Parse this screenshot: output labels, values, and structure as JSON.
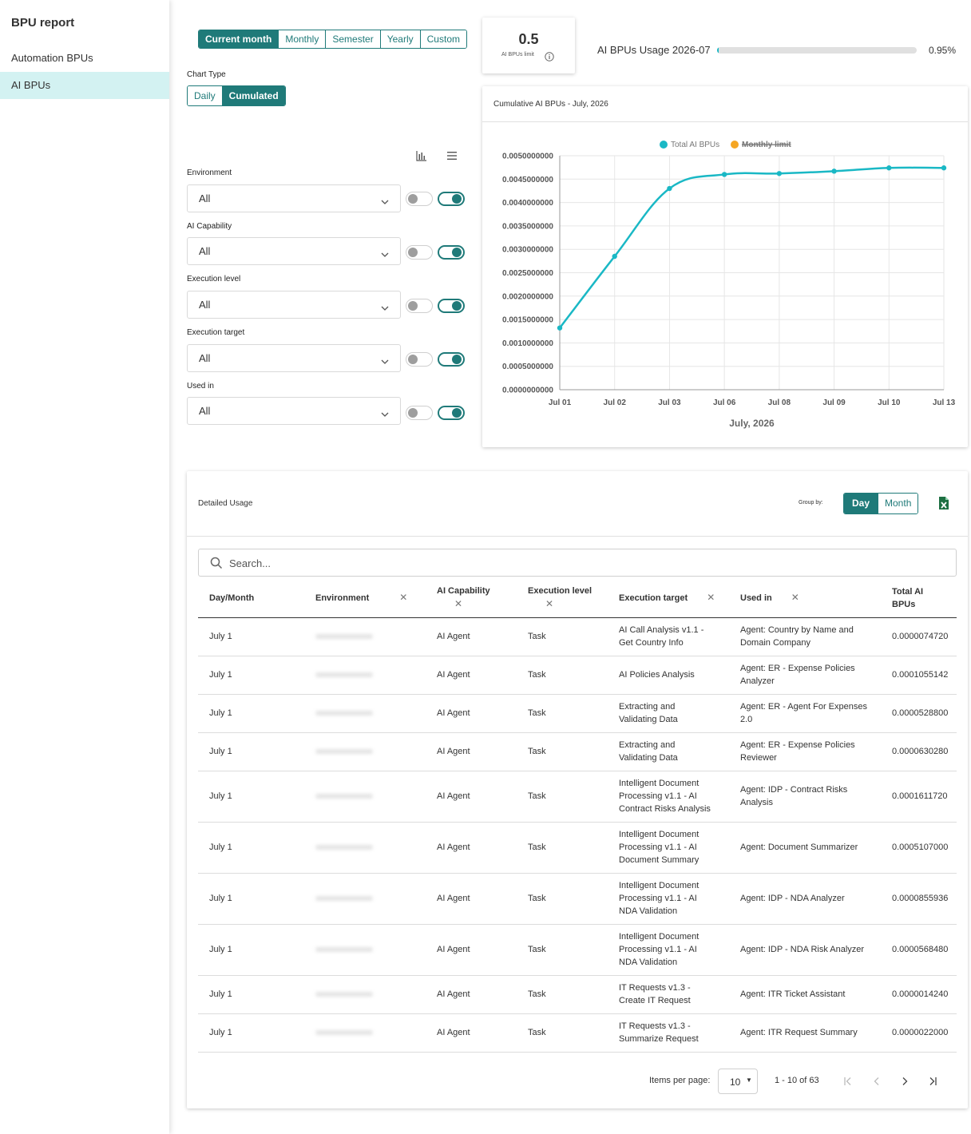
{
  "sidebar": {
    "title": "BPU report",
    "items": [
      {
        "label": "Automation BPUs",
        "active": false
      },
      {
        "label": "AI BPUs",
        "active": true
      }
    ]
  },
  "period_tabs": [
    "Current month",
    "Monthly",
    "Semester",
    "Yearly",
    "Custom"
  ],
  "period_active": "Current month",
  "chart_type": {
    "label": "Chart Type",
    "options": [
      "Daily",
      "Cumulated"
    ],
    "active": "Cumulated"
  },
  "view_icons": [
    "bar-chart-icon",
    "menu-icon"
  ],
  "filters": [
    {
      "label": "Environment",
      "value": "All"
    },
    {
      "label": "AI Capability",
      "value": "All"
    },
    {
      "label": "Execution level",
      "value": "All"
    },
    {
      "label": "Execution target",
      "value": "All"
    },
    {
      "label": "Used in",
      "value": "All"
    }
  ],
  "limit_card": {
    "value": "0.5",
    "label": "AI BPUs limit"
  },
  "usage": {
    "label": "AI BPUs Usage 2026-07",
    "percent_text": "0.95%",
    "fraction": 0.0095
  },
  "colors": {
    "accent": "#1f7a79",
    "series": "#1ab8c5",
    "limit": "#f5a623"
  },
  "chart_data": {
    "type": "line",
    "title": "Cumulative AI BPUs - July, 2026",
    "xlabel": "July, 2026",
    "ylabel": "",
    "categories": [
      "Jul 01",
      "Jul 02",
      "Jul 03",
      "Jul 06",
      "Jul 08",
      "Jul 09",
      "Jul 10",
      "Jul 13"
    ],
    "series": [
      {
        "name": "Total AI BPUs",
        "values": [
          0.00132,
          0.00285,
          0.0043,
          0.0046,
          0.00462,
          0.00467,
          0.00474,
          0.00474
        ],
        "visible": true
      },
      {
        "name": "Monthly limit",
        "values": [],
        "visible": false
      }
    ],
    "ylim": [
      0,
      0.005
    ],
    "yticks": [
      "0.0050000000",
      "0.0045000000",
      "0.0040000000",
      "0.0035000000",
      "0.0030000000",
      "0.0025000000",
      "0.0020000000",
      "0.0015000000",
      "0.0010000000",
      "0.0005000000",
      "0.0000000000"
    ],
    "grid": true,
    "legend": "top"
  },
  "table": {
    "title": "Detailed Usage",
    "group_by_label": "Group by:",
    "group_by_options": [
      "Day",
      "Month"
    ],
    "group_by_active": "Day",
    "search_placeholder": "Search...",
    "columns": [
      "Day/Month",
      "Environment",
      "AI Capability",
      "Execution level",
      "Execution target",
      "Used in",
      "Total AI BPUs"
    ],
    "rows": [
      {
        "day": "July 1",
        "capability": "AI Agent",
        "level": "Task",
        "target": "AI Call Analysis v1.1 - Get Country Info",
        "used_in": "Agent: Country by Name and Domain Company",
        "total": "0.0000074720"
      },
      {
        "day": "July 1",
        "capability": "AI Agent",
        "level": "Task",
        "target": "AI Policies Analysis",
        "used_in": "Agent: ER - Expense Policies Analyzer",
        "total": "0.0001055142"
      },
      {
        "day": "July 1",
        "capability": "AI Agent",
        "level": "Task",
        "target": "Extracting and Validating Data",
        "used_in": "Agent: ER - Agent For Expenses 2.0",
        "total": "0.0000528800"
      },
      {
        "day": "July 1",
        "capability": "AI Agent",
        "level": "Task",
        "target": "Extracting and Validating Data",
        "used_in": "Agent: ER - Expense Policies Reviewer",
        "total": "0.0000630280"
      },
      {
        "day": "July 1",
        "capability": "AI Agent",
        "level": "Task",
        "target": "Intelligent Document Processing v1.1 - AI Contract Risks Analysis",
        "used_in": "Agent: IDP - Contract Risks Analysis",
        "total": "0.0001611720"
      },
      {
        "day": "July 1",
        "capability": "AI Agent",
        "level": "Task",
        "target": "Intelligent Document Processing v1.1 - AI Document Summary",
        "used_in": "Agent: Document Summarizer",
        "total": "0.0005107000"
      },
      {
        "day": "July 1",
        "capability": "AI Agent",
        "level": "Task",
        "target": "Intelligent Document Processing v1.1 - AI NDA Validation",
        "used_in": "Agent: IDP - NDA Analyzer",
        "total": "0.0000855936"
      },
      {
        "day": "July 1",
        "capability": "AI Agent",
        "level": "Task",
        "target": "Intelligent Document Processing v1.1 - AI NDA Validation",
        "used_in": "Agent: IDP - NDA Risk Analyzer",
        "total": "0.0000568480"
      },
      {
        "day": "July 1",
        "capability": "AI Agent",
        "level": "Task",
        "target": "IT Requests v1.3 - Create IT Request",
        "used_in": "Agent: ITR Ticket Assistant",
        "total": "0.0000014240"
      },
      {
        "day": "July 1",
        "capability": "AI Agent",
        "level": "Task",
        "target": "IT Requests v1.3 - Summarize Request",
        "used_in": "Agent: ITR Request Summary",
        "total": "0.0000022000"
      }
    ]
  },
  "paginator": {
    "items_per_page_label": "Items per page:",
    "page_size": "10",
    "range": "1 - 10 of 63"
  }
}
